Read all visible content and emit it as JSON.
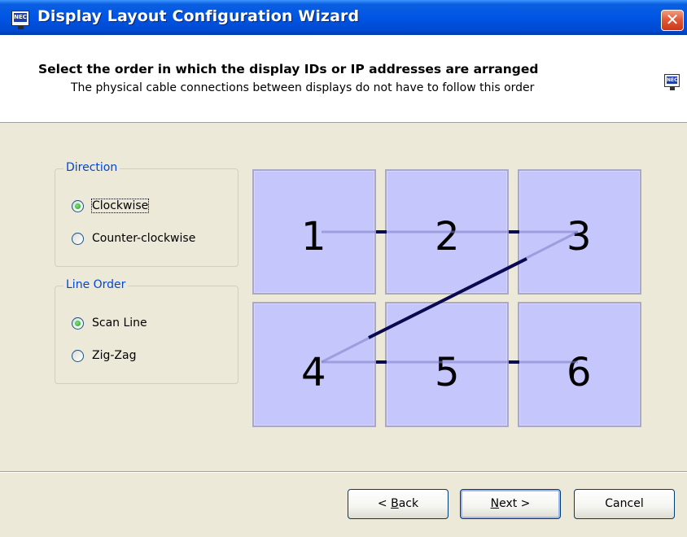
{
  "window": {
    "title": "Display Layout Configuration Wizard",
    "close_glyph": "✕",
    "icon": "monitor-nec-icon",
    "icon_text": "NEC"
  },
  "header": {
    "title": "Select the order in which the display IDs or IP addresses are arranged",
    "subtitle": "The physical cable connections between displays do not have to follow this order"
  },
  "direction": {
    "label": "Direction",
    "options": [
      {
        "label": "Clockwise",
        "checked": true
      },
      {
        "label": "Counter-clockwise",
        "checked": false
      }
    ]
  },
  "line_order": {
    "label": "Line Order",
    "options": [
      {
        "label": "Scan Line",
        "checked": true
      },
      {
        "label": "Zig-Zag",
        "checked": false
      }
    ]
  },
  "displays": {
    "rows": 2,
    "cols": 3,
    "tiles": [
      "1",
      "2",
      "3",
      "4",
      "5",
      "6"
    ],
    "tile_color": "#c5c6fc",
    "link_color": "#0a0a50"
  },
  "buttons": {
    "back": {
      "mnemonic": "B",
      "rest": "ack",
      "prefix": "< "
    },
    "next": {
      "mnemonic": "N",
      "rest": "ext >",
      "prefix": ""
    },
    "cancel": "Cancel"
  },
  "colors": {
    "titlebar": "#0055e5",
    "group_label": "#0046d5",
    "dialog_bg": "#ece9d8"
  }
}
